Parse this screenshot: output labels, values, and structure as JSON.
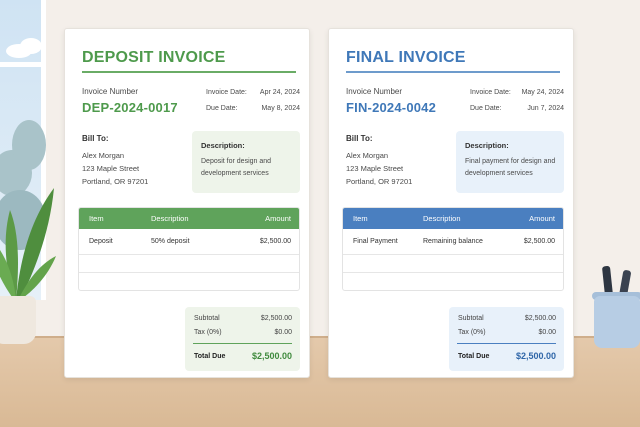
{
  "invoices": {
    "deposit": {
      "title": "DEPOSIT INVOICE",
      "number_label": "Invoice Number",
      "number": "DEP-2024-0017",
      "invoice_date_label": "Invoice Date:",
      "invoice_date": "Apr 24, 2024",
      "due_date_label": "Due Date:",
      "due_date": "May 8, 2024",
      "bill_to_label": "Bill To:",
      "bill_to": [
        "Alex Morgan",
        "123 Maple Street",
        "Portland, OR 97201"
      ],
      "description_label": "Description:",
      "description": "Deposit for design and development services",
      "table": {
        "headers": [
          "Item",
          "Description",
          "Amount"
        ],
        "rows": [
          {
            "item": "Deposit",
            "description": "50% deposit",
            "amount": "$2,500.00"
          }
        ]
      },
      "totals": {
        "subtotal_label": "Subtotal",
        "subtotal": "$2,500.00",
        "tax_label": "Tax (0%)",
        "tax": "$0.00",
        "total_label": "Total Due",
        "total": "$2,500.00"
      },
      "accent": "#5fa35b"
    },
    "final": {
      "title": "FINAL INVOICE",
      "number_label": "Invoice Number",
      "number": "FIN-2024-0042",
      "invoice_date_label": "Invoice Date:",
      "invoice_date": "May 24, 2024",
      "due_date_label": "Due Date:",
      "due_date": "Jun 7, 2024",
      "bill_to_label": "Bill To:",
      "bill_to": [
        "Alex Morgan",
        "123 Maple Street",
        "Portland, OR 97201"
      ],
      "description_label": "Description:",
      "description": "Final payment for design and development services",
      "table": {
        "headers": [
          "Item",
          "Description",
          "Amount"
        ],
        "rows": [
          {
            "item": "Final Payment",
            "description": "Remaining balance",
            "amount": "$2,500.00"
          }
        ]
      },
      "totals": {
        "subtotal_label": "Subtotal",
        "subtotal": "$2,500.00",
        "tax_label": "Tax (0%)",
        "tax": "$0.00",
        "total_label": "Total Due",
        "total": "$2,500.00"
      },
      "accent": "#4a7fc0"
    }
  },
  "scene_icons": [
    "plant-icon",
    "pen-cup-icon",
    "window-icon"
  ]
}
